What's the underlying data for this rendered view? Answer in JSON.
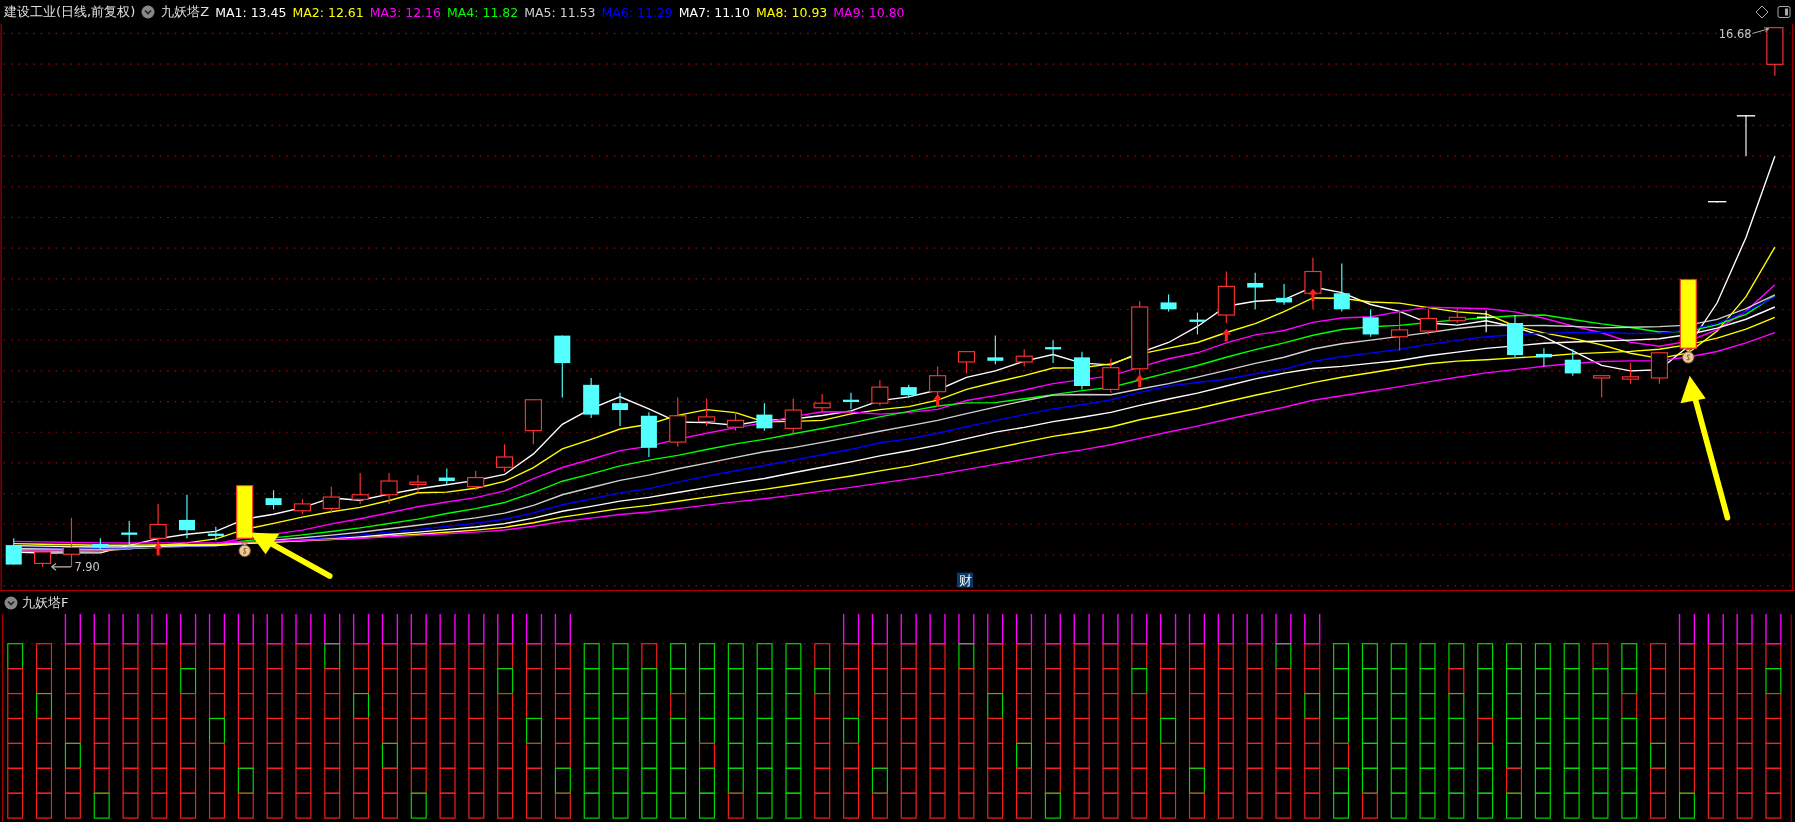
{
  "header": {
    "title": "建设工业(日线,前复权)",
    "indicator": "九妖塔Z",
    "moving_averages": [
      {
        "text": "MA1: 13.45",
        "color": "#ffffff"
      },
      {
        "text": "MA2: 12.61",
        "color": "#ffff00"
      },
      {
        "text": "MA3: 12.16",
        "color": "#ff00ff"
      },
      {
        "text": "MA4: 11.82",
        "color": "#00ff00"
      },
      {
        "text": "MA5: 11.53",
        "color": "#d0d0d0"
      },
      {
        "text": "MA6: 11.29",
        "color": "#0000ff"
      },
      {
        "text": "MA7: 11.10",
        "color": "#ffffff"
      },
      {
        "text": "MA8: 10.93",
        "color": "#ffff00"
      },
      {
        "text": "MA9: 10.80",
        "color": "#ff00ff"
      }
    ]
  },
  "main_chart": {
    "high_label": "16.68",
    "low_label": "7.90",
    "event_marker": "财"
  },
  "sub_panel": {
    "title": "九妖塔F"
  }
}
